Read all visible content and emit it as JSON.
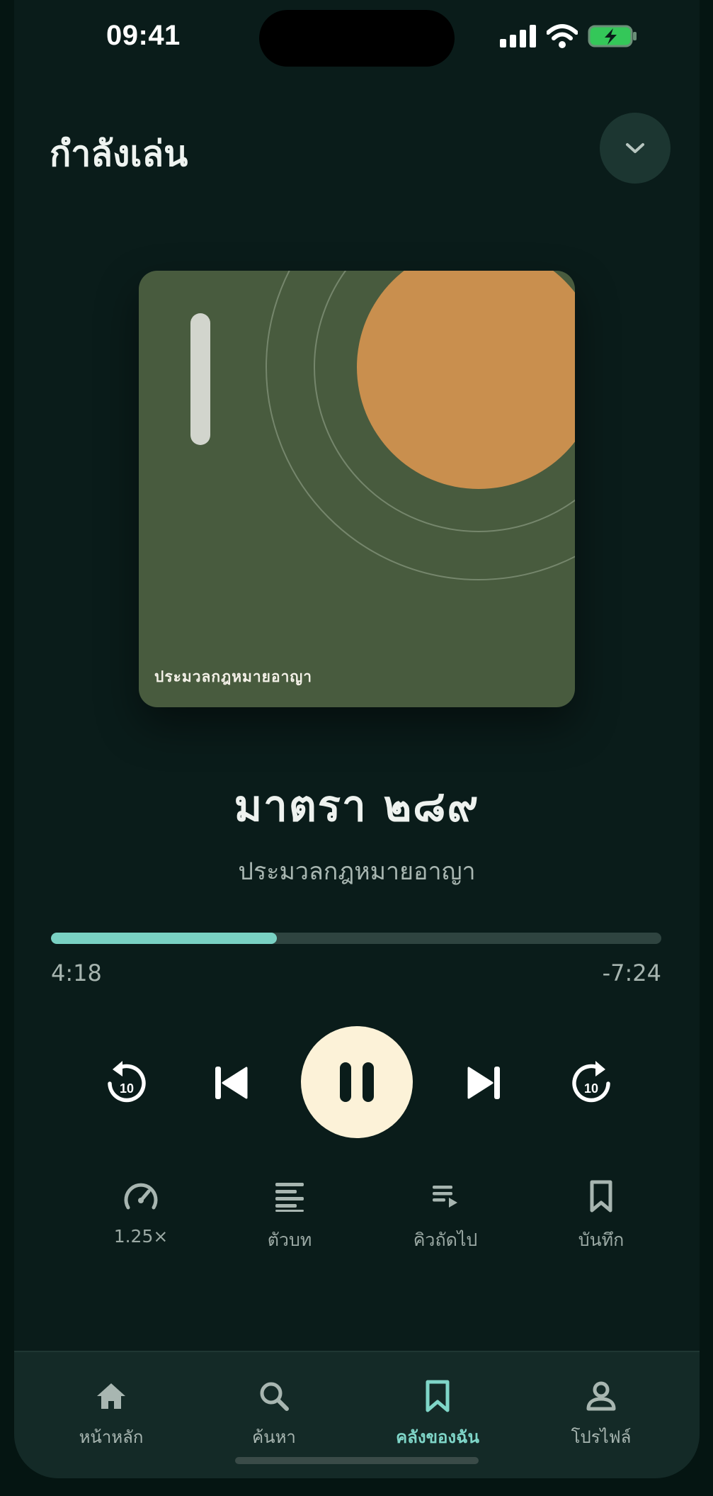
{
  "status_bar": {
    "time": "09:41"
  },
  "header": {
    "title": "กำลังเล่น"
  },
  "artwork": {
    "caption": "ประมวลกฎหมายอาญา",
    "background_color": "#485b3e",
    "sun_color": "#c98f4e"
  },
  "track": {
    "title": "มาตรา ๒๘๙",
    "subtitle": "ประมวลกฎหมายอาญา"
  },
  "playback": {
    "elapsed": "4:18",
    "remaining": "-7:24",
    "progress_fraction": 0.37,
    "accent_color": "#79d1c3"
  },
  "transport": {
    "rewind_seconds": "10",
    "forward_seconds": "10"
  },
  "actions": [
    {
      "label": "1.25×",
      "icon": "speedometer-icon"
    },
    {
      "label": "ตัวบท",
      "icon": "text-lines-icon"
    },
    {
      "label": "คิวถัดไป",
      "icon": "queue-icon"
    },
    {
      "label": "บันทึก",
      "icon": "bookmark-icon"
    }
  ],
  "tabs": [
    {
      "label": "หน้าหลัก",
      "icon": "home-icon",
      "active": false
    },
    {
      "label": "ค้นหา",
      "icon": "search-icon",
      "active": false
    },
    {
      "label": "คลังของฉัน",
      "icon": "bookmark-icon",
      "active": true
    },
    {
      "label": "โปรไฟล์",
      "icon": "person-icon",
      "active": false
    }
  ]
}
